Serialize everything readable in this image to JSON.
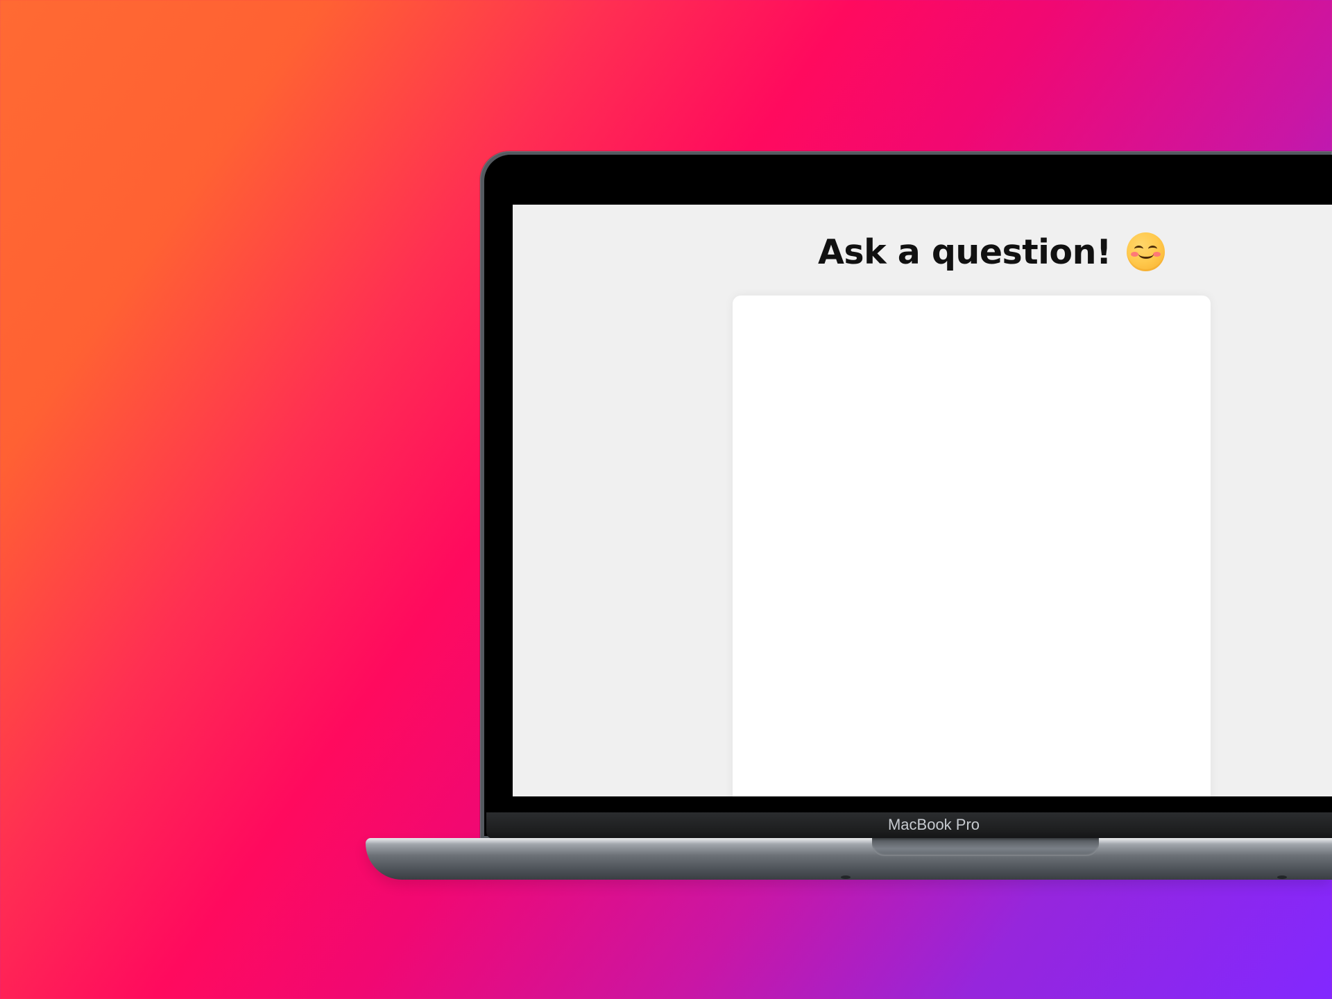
{
  "screen": {
    "title": "Ask a question!",
    "emoji_icon": "smiling-face-icon"
  },
  "laptop": {
    "model_label": "MacBook Pro"
  },
  "colors": {
    "background_start": "#ff6a33",
    "background_mid": "#ff0a5e",
    "background_end": "#8228ff",
    "screen_background": "#f0f0f0",
    "card_background": "#ffffff",
    "title_text": "#111111"
  }
}
